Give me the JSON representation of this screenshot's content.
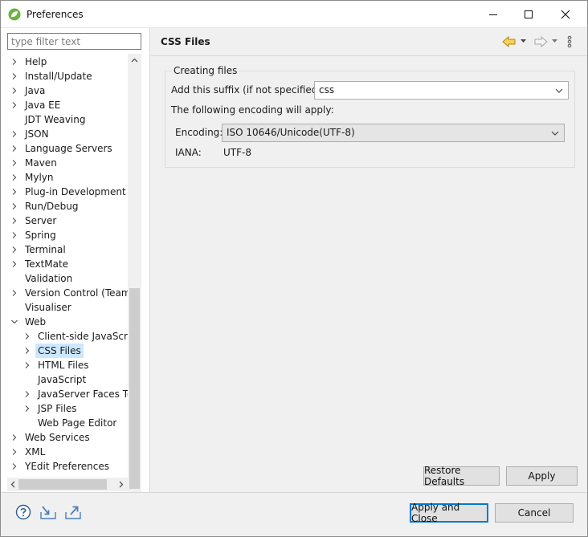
{
  "window": {
    "title": "Preferences",
    "app_icon": "spring-leaf-icon"
  },
  "filter": {
    "placeholder": "type filter text",
    "value": ""
  },
  "tree": [
    {
      "label": "Help",
      "level": 0,
      "expander": "collapsed"
    },
    {
      "label": "Install/Update",
      "level": 0,
      "expander": "collapsed"
    },
    {
      "label": "Java",
      "level": 0,
      "expander": "collapsed"
    },
    {
      "label": "Java EE",
      "level": 0,
      "expander": "collapsed"
    },
    {
      "label": "JDT Weaving",
      "level": 0,
      "expander": "none"
    },
    {
      "label": "JSON",
      "level": 0,
      "expander": "collapsed"
    },
    {
      "label": "Language Servers",
      "level": 0,
      "expander": "collapsed"
    },
    {
      "label": "Maven",
      "level": 0,
      "expander": "collapsed"
    },
    {
      "label": "Mylyn",
      "level": 0,
      "expander": "collapsed"
    },
    {
      "label": "Plug-in Development",
      "level": 0,
      "expander": "collapsed"
    },
    {
      "label": "Run/Debug",
      "level": 0,
      "expander": "collapsed"
    },
    {
      "label": "Server",
      "level": 0,
      "expander": "collapsed"
    },
    {
      "label": "Spring",
      "level": 0,
      "expander": "collapsed"
    },
    {
      "label": "Terminal",
      "level": 0,
      "expander": "collapsed"
    },
    {
      "label": "TextMate",
      "level": 0,
      "expander": "collapsed"
    },
    {
      "label": "Validation",
      "level": 0,
      "expander": "none"
    },
    {
      "label": "Version Control (Team)",
      "level": 0,
      "expander": "collapsed"
    },
    {
      "label": "Visualiser",
      "level": 0,
      "expander": "none"
    },
    {
      "label": "Web",
      "level": 0,
      "expander": "expanded"
    },
    {
      "label": "Client-side JavaScript",
      "level": 1,
      "expander": "collapsed"
    },
    {
      "label": "CSS Files",
      "level": 1,
      "expander": "collapsed",
      "selected": true
    },
    {
      "label": "HTML Files",
      "level": 1,
      "expander": "collapsed"
    },
    {
      "label": "JavaScript",
      "level": 1,
      "expander": "none"
    },
    {
      "label": "JavaServer Faces Tools",
      "level": 1,
      "expander": "collapsed"
    },
    {
      "label": "JSP Files",
      "level": 1,
      "expander": "collapsed"
    },
    {
      "label": "Web Page Editor",
      "level": 1,
      "expander": "none"
    },
    {
      "label": "Web Services",
      "level": 0,
      "expander": "collapsed"
    },
    {
      "label": "XML",
      "level": 0,
      "expander": "collapsed"
    },
    {
      "label": "YEdit Preferences",
      "level": 0,
      "expander": "collapsed"
    }
  ],
  "page": {
    "title": "CSS Files",
    "nav_icons": [
      "back-arrow-icon",
      "back-dropdown-icon",
      "forward-arrow-icon",
      "forward-dropdown-icon",
      "view-menu-icon"
    ]
  },
  "creating_files": {
    "legend": "Creating files",
    "suffix_label": "Add this suffix (if not specified):",
    "suffix_value": "css",
    "encoding_note": "The following encoding will apply:",
    "encoding_label": "Encoding:",
    "encoding_value": "ISO 10646/Unicode(UTF-8)",
    "iana_label": "IANA:",
    "iana_value": "UTF-8"
  },
  "buttons": {
    "restore_defaults": "Restore Defaults",
    "apply": "Apply",
    "apply_and_close": "Apply and Close",
    "cancel": "Cancel"
  },
  "bottom_icons": [
    "help-icon",
    "import-icon",
    "export-icon"
  ],
  "colors": {
    "selection": "#cce8ff",
    "accent": "#0078d7",
    "back_arrow": "#e8b80a"
  }
}
